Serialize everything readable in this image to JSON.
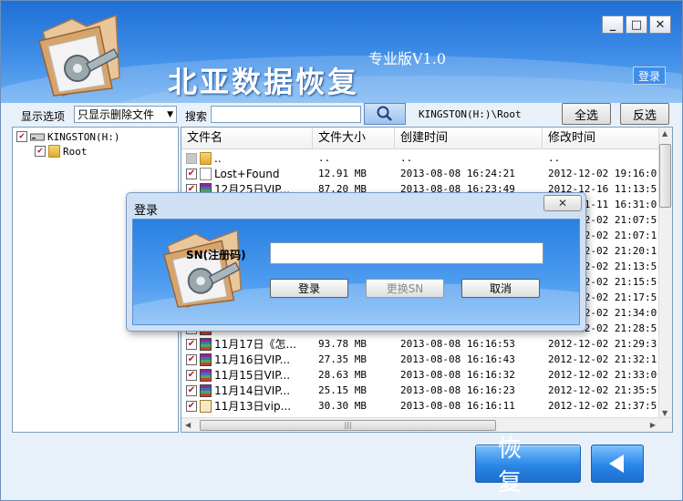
{
  "window": {
    "title": "北亚数据恢复",
    "version": "专业版V1.0",
    "login_label": "登录",
    "minimize": "_",
    "maximize": "□",
    "close": "✕"
  },
  "toolbar": {
    "filter_label": "显示选项",
    "filter_value": "只显示删除文件",
    "search_label": "搜索",
    "search_value": "",
    "path": "KINGSTON(H:)\\Root",
    "select_all": "全选",
    "invert": "反选"
  },
  "tree": {
    "drive": "KINGSTON(H:)",
    "folder": "Root"
  },
  "list": {
    "columns": [
      "文件名",
      "文件大小",
      "创建时间",
      "修改时间"
    ],
    "rows": [
      {
        "icon": "folder",
        "checked": "gray",
        "name": "..",
        "size": "..",
        "created": "..",
        "modified": ".."
      },
      {
        "icon": "file",
        "checked": "yes",
        "name": "Lost+Found",
        "size": "12.91 MB",
        "created": "2013-08-08 16:24:21",
        "modified": "2012-12-02 19:16:0"
      },
      {
        "icon": "rar",
        "checked": "yes",
        "name": "12月25日VIP...",
        "size": "87.20 MB",
        "created": "2013-08-08 16:23:49",
        "modified": "2012-12-16 11:13:5"
      },
      {
        "icon": "rar",
        "checked": "yes",
        "name": "",
        "size": "",
        "created": "",
        "modified": "2012-11-11 16:31:0"
      },
      {
        "icon": "rar",
        "checked": "yes",
        "name": "",
        "size": "",
        "created": "",
        "modified": "2012-12-02 21:07:5"
      },
      {
        "icon": "rar",
        "checked": "yes",
        "name": "",
        "size": "",
        "created": "",
        "modified": "2012-12-02 21:07:1"
      },
      {
        "icon": "rar",
        "checked": "yes",
        "name": "",
        "size": "",
        "created": "",
        "modified": "2012-12-02 21:20:1"
      },
      {
        "icon": "rar",
        "checked": "yes",
        "name": "",
        "size": "",
        "created": "",
        "modified": "2012-12-02 21:13:5"
      },
      {
        "icon": "rar",
        "checked": "yes",
        "name": "",
        "size": "",
        "created": "",
        "modified": "2012-12-02 21:15:5"
      },
      {
        "icon": "rar",
        "checked": "yes",
        "name": "",
        "size": "",
        "created": "",
        "modified": "2012-12-02 21:17:5"
      },
      {
        "icon": "rar",
        "checked": "yes",
        "name": "",
        "size": "",
        "created": "",
        "modified": "2012-12-02 21:34:0"
      },
      {
        "icon": "rar",
        "checked": "yes",
        "name": "",
        "size": "",
        "created": "",
        "modified": "2012-12-02 21:28:5"
      },
      {
        "icon": "rar",
        "checked": "yes",
        "name": "11月17日《怎...",
        "size": "93.78 MB",
        "created": "2013-08-08 16:16:53",
        "modified": "2012-12-02 21:29:3"
      },
      {
        "icon": "rar",
        "checked": "yes",
        "name": "11月16日VIP...",
        "size": "27.35 MB",
        "created": "2013-08-08 16:16:43",
        "modified": "2012-12-02 21:32:1"
      },
      {
        "icon": "rar",
        "checked": "yes",
        "name": "11月15日VIP...",
        "size": "28.63 MB",
        "created": "2013-08-08 16:16:32",
        "modified": "2012-12-02 21:33:0"
      },
      {
        "icon": "rar",
        "checked": "yes",
        "name": "11月14日VIP...",
        "size": "25.15 MB",
        "created": "2013-08-08 16:16:23",
        "modified": "2012-12-02 21:35:5"
      },
      {
        "icon": "pdf",
        "checked": "yes",
        "name": "11月13日vip...",
        "size": "30.30 MB",
        "created": "2013-08-08 16:16:11",
        "modified": "2012-12-02 21:37:5"
      }
    ]
  },
  "buttons": {
    "recover": "恢复"
  },
  "dialog": {
    "title": "登录",
    "close": "✕",
    "sn_label": "SN(注册码)",
    "sn_value": "",
    "login": "登录",
    "change_sn": "更换SN",
    "cancel": "取消"
  },
  "colors": {
    "banner": "#3f8ee8",
    "accent": "#2a86e6",
    "check": "#c0141a"
  }
}
